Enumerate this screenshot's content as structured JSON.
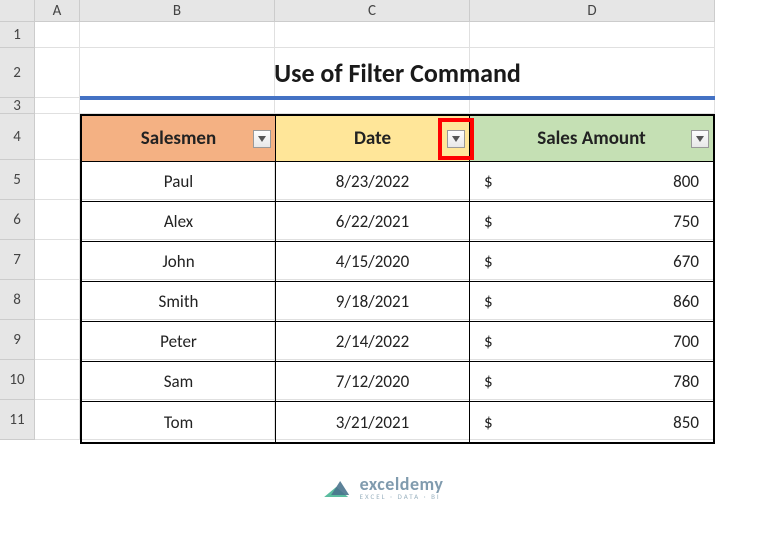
{
  "columns": {
    "A": "A",
    "B": "B",
    "C": "C",
    "D": "D"
  },
  "rows": [
    "1",
    "2",
    "3",
    "4",
    "5",
    "6",
    "7",
    "8",
    "9",
    "10",
    "11"
  ],
  "title": "Use of Filter Command",
  "headers": {
    "salesmen": "Salesmen",
    "date": "Date",
    "amount": "Sales Amount"
  },
  "currency_symbol": "$",
  "data": [
    {
      "salesman": "Paul",
      "date": "8/23/2022",
      "amount": "800"
    },
    {
      "salesman": "Alex",
      "date": "6/22/2021",
      "amount": "750"
    },
    {
      "salesman": "John",
      "date": "4/15/2020",
      "amount": "670"
    },
    {
      "salesman": "Smith",
      "date": "9/18/2021",
      "amount": "860"
    },
    {
      "salesman": "Peter",
      "date": "2/14/2022",
      "amount": "700"
    },
    {
      "salesman": "Sam",
      "date": "7/12/2020",
      "amount": "780"
    },
    {
      "salesman": "Tom",
      "date": "3/21/2021",
      "amount": "850"
    }
  ],
  "watermark": {
    "brand": "exceldemy",
    "sub": "EXCEL · DATA · BI"
  }
}
